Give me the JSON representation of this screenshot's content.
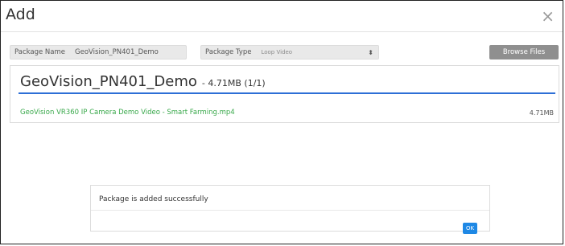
{
  "dialog": {
    "title": "Add",
    "close_glyph": "×"
  },
  "form": {
    "package_name_label": "Package Name",
    "package_name_value": "GeoVision_PN401_Demo",
    "package_type_label": "Package Type",
    "package_type_value": "Loop Video",
    "browse_label": "Browse Files"
  },
  "package": {
    "name": "GeoVision_PN401_Demo",
    "meta": "- 4.71MB (1/1)",
    "files": [
      {
        "name": "GeoVision VR360 IP Camera Demo Video - Smart Farming.mp4",
        "size": "4.71MB"
      }
    ]
  },
  "alert": {
    "message": "Package is added successfully",
    "ok_label": "OK"
  },
  "colors": {
    "accent": "#2d6fd6",
    "file_green": "#38a84a",
    "ok_blue": "#1e88e5",
    "browse_gray": "#8f8f8f"
  }
}
